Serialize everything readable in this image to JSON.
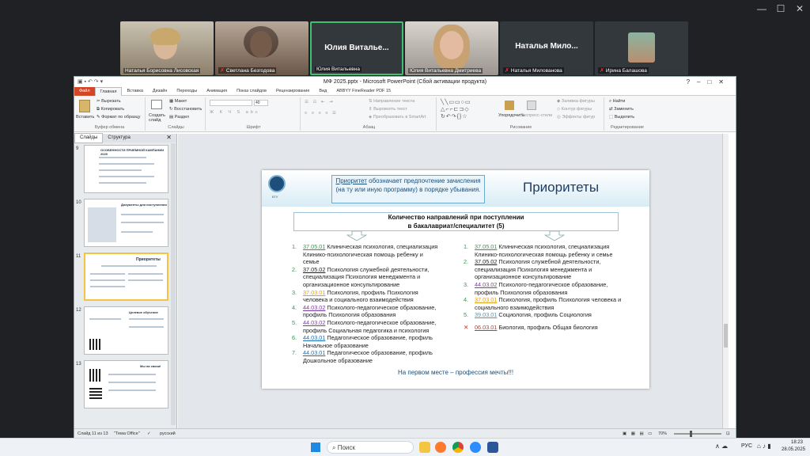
{
  "window_controls": {
    "minimize": "—",
    "maximize": "☐",
    "close": "✕"
  },
  "participants": [
    {
      "name": "Наталья Борисовна Лисовская",
      "type": "video",
      "muted": false
    },
    {
      "name": "Светлана Безгодова",
      "type": "video",
      "muted": true
    },
    {
      "big": "Юлия  Виталье...",
      "name": "Юлия Витальевна",
      "type": "name",
      "muted": false,
      "active": true
    },
    {
      "name": "Юлия Витальевна Дмитриева",
      "type": "video",
      "muted": false
    },
    {
      "big": "Наталья  Мило...",
      "name": "Наталья Милованова",
      "type": "name",
      "muted": true
    },
    {
      "name": "Ирина Балашова",
      "type": "avatar",
      "muted": true
    }
  ],
  "ppt": {
    "title": "МФ 2025.pptx - Microsoft PowerPoint (Сбой активации продукта)",
    "tabs": [
      "Файл",
      "Главная",
      "Вставка",
      "Дизайн",
      "Переходы",
      "Анимация",
      "Показ слайдов",
      "Рецензирование",
      "Вид",
      "ABBYY FineReader PDF 15"
    ],
    "ribbon": {
      "clipboard": {
        "paste": "Вставить",
        "cut": "Вырезать",
        "copy": "Копировать",
        "format": "Формат по образцу",
        "label": "Буфер обмена"
      },
      "slides": {
        "create": "Создать слайд",
        "layout": "Макет",
        "reset": "Восстановить",
        "section": "Раздел",
        "label": "Слайды"
      },
      "font": {
        "size": "40",
        "label": "Шрифт"
      },
      "paragraph": {
        "dir": "Направление текста",
        "align": "Выровнять текст",
        "smartart": "Преобразовать в SmartArt",
        "label": "Абзац"
      },
      "drawing": {
        "arrange": "Упорядочить",
        "styles": "Экспресс-стили",
        "fill": "Заливка фигуры",
        "outline": "Контур фигуры",
        "effects": "Эффекты фигур",
        "label": "Рисование"
      },
      "editing": {
        "find": "Найти",
        "replace": "Заменить",
        "select": "Выделить",
        "label": "Редактирование"
      }
    },
    "sidebar_tabs": [
      "Слайды",
      "Структура"
    ],
    "thumbnails": [
      {
        "num": "9",
        "title": "ОСОБЕННОСТИ ПРИЕМНОЙ КАМПАНИИ 2025"
      },
      {
        "num": "10",
        "title": "Документы для поступления"
      },
      {
        "num": "11",
        "title": "Приоритеты",
        "selected": true
      },
      {
        "num": "12",
        "title": "Целевое обучение"
      },
      {
        "num": "13",
        "title": "Мы на связи!"
      }
    ],
    "slide": {
      "logo_text": "ЕГУ",
      "priority_word": "Приоритет",
      "priority_text": " обозначает предпочтение зачисления (на ту или иную программу) в порядке убывания.",
      "title": "Приоритеты",
      "count_line1": "Количество направлений при поступлении",
      "count_line2": "в бакалавриат/специалитет (5)",
      "left": [
        {
          "n": "1.",
          "code": "37.05.01",
          "text": " Клиническая психология, специализация Клинико-психологическая помощь ребенку и семье",
          "color": "#2e9a4a"
        },
        {
          "n": "2.",
          "code": "37.05.02",
          "text": " Психология служебной деятельности, специализация Психология менеджмента и организационное консультирование",
          "color": "#222222"
        },
        {
          "n": "3.",
          "code": "37.03.01",
          "text": " Психология, профиль Психология человека и социального взаимодействия",
          "color": "#e0a21a"
        },
        {
          "n": "4.",
          "code": "44.03.02",
          "text": " Психолого-педагогическое образование, профиль Психология образования",
          "color": "#7b3fa0"
        },
        {
          "n": "5.",
          "code": "44.03.02",
          "text": " Психолого-педагогическое образование, профиль Социальная педагогика и психология",
          "color": "#7b3fa0"
        },
        {
          "n": "6.",
          "code": "44.03.01",
          "text": " Педагогическое образование, профиль Начальное образование",
          "color": "#1f6fb5"
        },
        {
          "n": "7.",
          "code": "44.03.01",
          "text": " Педагогическое образование, профиль Дошкольное образование",
          "color": "#1f6fb5"
        }
      ],
      "right": [
        {
          "n": "1.",
          "code": "37.05.01",
          "text": " Клиническая психология, специализация Клинико-психологическая помощь ребенку и семье",
          "color": "#2e9a4a"
        },
        {
          "n": "2.",
          "code": "37.05.02",
          "text": " Психология служебной деятельности, специализация Психология менеджмента и организационное консультирование",
          "color": "#222222"
        },
        {
          "n": "3.",
          "code": "44.03.02",
          "text": " Психолого-педагогическое образование, профиль Психология образования",
          "color": "#7b3fa0"
        },
        {
          "n": "4.",
          "code": "37.03.01",
          "text": " Психология, профиль Психология человека и социального взаимодействия",
          "color": "#e0a21a"
        },
        {
          "n": "5.",
          "code": "39.03.01",
          "text": " Социология, профиль Социология",
          "color": "#3aa0c8"
        },
        {
          "n": "✕",
          "code": "06.03.01",
          "text": " Биология, профиль Общая биология",
          "color": "#c0392b",
          "cross": true
        }
      ],
      "footer": "На первом месте – профессия мечты!!!"
    },
    "status": {
      "slide": "Слайд 11 из 13",
      "theme": "\"Тема Office\"",
      "lang": "русский",
      "zoom": "70%"
    }
  },
  "taskbar": {
    "search": "Поиск",
    "lang": "РУС",
    "time": "18:23",
    "date": "28.05.2025"
  }
}
